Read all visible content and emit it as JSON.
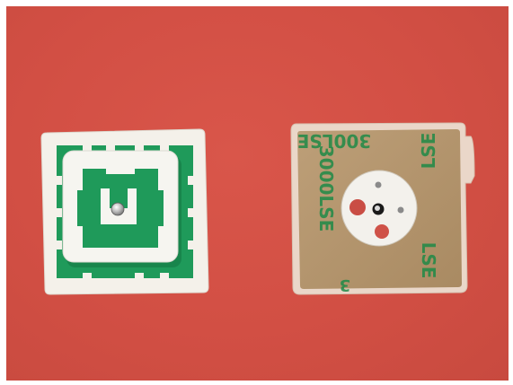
{
  "photo": {
    "background_color": "#d3524a",
    "objects": [
      {
        "id": "patch-antenna-front",
        "colors": {
          "substrate": "#f4f1ea",
          "copper": "#1f9a5a",
          "ceramic": "#f6f5f0",
          "pin": "#c9c9c9"
        }
      },
      {
        "id": "patch-antenna-back",
        "colors": {
          "adhesive": "#b99870",
          "liner": "#e9e2d4",
          "text": "#1f8a47"
        },
        "printed_text": [
          "3000LSE",
          "300LSE",
          "LSE",
          "LSE",
          "3"
        ]
      }
    ]
  }
}
